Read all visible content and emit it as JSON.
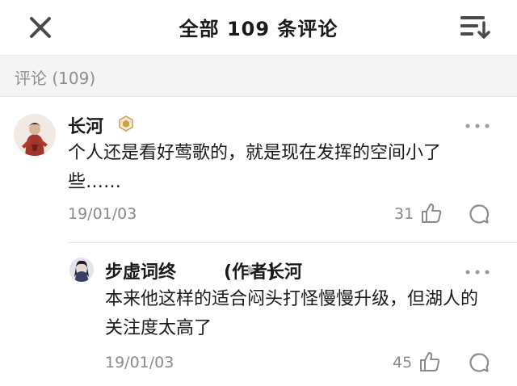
{
  "header": {
    "title": "全部 109 条评论"
  },
  "section": {
    "label": "评论 (109)"
  },
  "comments": [
    {
      "username": "长河",
      "text": "个人还是看好莺歌的，就是现在发挥的空间小了些……",
      "date": "19/01/03",
      "likes": "31"
    },
    {
      "username": "步虚词终",
      "author_tag": "(作者)",
      "reply_to": "长河",
      "text": "本来他这样的适合闷头打怪慢慢升级，但湖人的关注度太高了",
      "date": "19/01/03",
      "likes": "45"
    }
  ],
  "colors": {
    "muted_text": "#8a8a8a",
    "section_bg": "#f4f4f4",
    "badge_gold": "#c9a24a"
  }
}
